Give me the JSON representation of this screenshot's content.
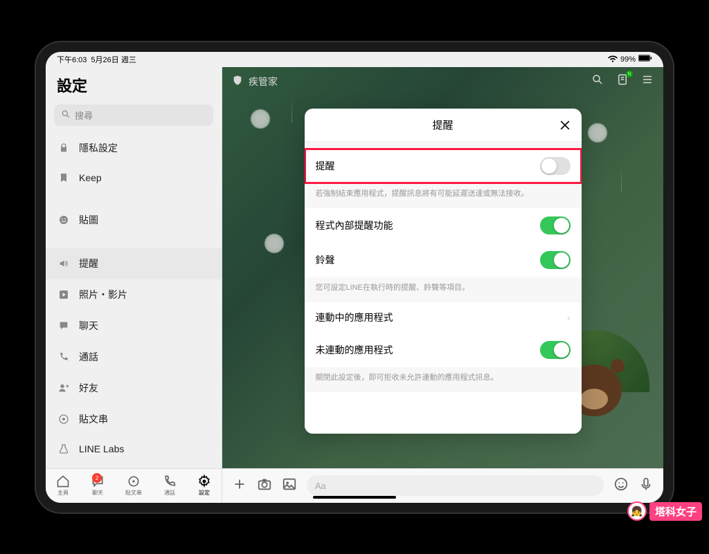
{
  "status": {
    "time": "下午6:03",
    "date": "5月26日 週三",
    "battery": "99%"
  },
  "sidebar": {
    "title": "設定",
    "search_placeholder": "搜尋",
    "items": [
      {
        "icon": "lock",
        "label": "隱私設定"
      },
      {
        "icon": "bookmark",
        "label": "Keep"
      },
      {
        "icon": "smile",
        "label": "貼圖"
      },
      {
        "icon": "speaker",
        "label": "提醒"
      },
      {
        "icon": "play",
        "label": "照片・影片"
      },
      {
        "icon": "chat",
        "label": "聊天"
      },
      {
        "icon": "phone",
        "label": "通話"
      },
      {
        "icon": "friend",
        "label": "好友"
      },
      {
        "icon": "timeline",
        "label": "貼文串"
      },
      {
        "icon": "flask",
        "label": "LINE Labs"
      }
    ]
  },
  "chat": {
    "title": "疾管家",
    "input_placeholder": "Aa"
  },
  "modal": {
    "title": "提醒",
    "row1_label": "提醒",
    "hint1": "若強制結束應用程式，提醒訊息將有可能延遲送達或無法接收。",
    "row2_label": "程式內部提醒功能",
    "row3_label": "鈴聲",
    "hint2": "您可設定LINE在執行時的提醒、鈴聲等項目。",
    "row4_label": "連動中的應用程式",
    "row5_label": "未連動的應用程式",
    "hint3": "關閉此設定後，即可拒收未允許連動的應用程式訊息。"
  },
  "tabs": {
    "home": "主頁",
    "chat": "聊天",
    "chat_badge": "2",
    "timeline": "貼文串",
    "call": "通話",
    "settings": "設定"
  },
  "watermark": {
    "text": "塔科女子"
  }
}
